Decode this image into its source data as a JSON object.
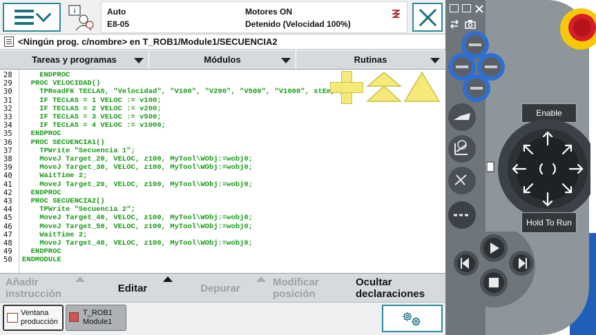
{
  "header": {
    "mode": "Auto",
    "system": "E8-05",
    "motors": "Motores ON",
    "state": "Detenido (Velocidad 100%)"
  },
  "path": "<Ningún prog. c/nombre> en T_ROB1/Module1/SECUENCIA2",
  "tabs": [
    {
      "label": "Tareas y programas"
    },
    {
      "label": "Módulos"
    },
    {
      "label": "Rutinas"
    }
  ],
  "code": {
    "lines": [
      {
        "n": "28",
        "text": "    ENDPROC"
      },
      {
        "n": "29",
        "text": "  PROC VELOCIDAD()"
      },
      {
        "n": "30",
        "text": "    TPReadFK TECLAS, \"Velocidad\", \"V100\", \"V200\", \"V500\", \"V1000\", stEmpty;"
      },
      {
        "n": "31",
        "text": "    IF TECLAS = 1 VELOC := v100;"
      },
      {
        "n": "32",
        "text": "    IF TECLAS = 2 VELOC := v200;"
      },
      {
        "n": "33",
        "text": "    IF TECLAS = 3 VELOC := v500;"
      },
      {
        "n": "34",
        "text": "    IF TECLAS = 4 VELOC := v1000;"
      },
      {
        "n": "35",
        "text": "  ENDPROC"
      },
      {
        "n": "36",
        "text": "  PROC SECUENCIA1()"
      },
      {
        "n": "37",
        "text": "    TPWrite \"Secuencia 1\";"
      },
      {
        "n": "38",
        "text": "    MoveJ Target_20, VELOC, z100, MyTool\\WObj:=wobj0;"
      },
      {
        "n": "39",
        "text": "    MoveJ Target_30, VELOC, z100, MyTool\\WObj:=wobj0;"
      },
      {
        "n": "40",
        "text": "    WaitTime 2;"
      },
      {
        "n": "41",
        "text": "    MoveJ Target_20, VELOC, z100, MyTool\\WObj:=wobj0;"
      },
      {
        "n": "42",
        "text": "  ENDPROC"
      },
      {
        "n": "43",
        "text": "  PROC SECUENCIA2()"
      },
      {
        "n": "44",
        "text": "    TPWrite \"Secuencia 2\";"
      },
      {
        "n": "45",
        "text": "    MoveJ Target_40, VELOC, z100, MyTool\\WObj:=wobj0;"
      },
      {
        "n": "46",
        "text": "    MoveJ Target_50, VELOC, z100, MyTool\\WObj:=wobj0;"
      },
      {
        "n": "47",
        "text": "    WaitTime 2;"
      },
      {
        "n": "48",
        "text": "    MoveJ Target_40, VELOC, z100, MyTool\\WObj:=wobj0;"
      },
      {
        "n": "49",
        "text": "  ENDPROC"
      },
      {
        "n": "50",
        "text": "ENDMODULE"
      }
    ]
  },
  "commands": {
    "anadir": {
      "line1": "Añadir",
      "line2": "instrucción"
    },
    "editar": "Editar",
    "depurar": "Depurar",
    "modificar": {
      "line1": "Modificar",
      "line2": "posición"
    },
    "ocultar": {
      "line1": "Ocultar",
      "line2": "declaraciones"
    }
  },
  "taskbar": {
    "production": {
      "line1": "Ventana",
      "line2": "producción"
    },
    "rob": {
      "line1": "T_ROB1",
      "line2": "Module1"
    }
  },
  "hardware": {
    "enable": "Enable",
    "hold_to_run": "Hold To Run"
  },
  "colors": {
    "code_green": "#1a9a1a",
    "accent_teal": "#2a8a9a",
    "edit_yellow": "#f5ea78",
    "estop_red": "#d4202a",
    "button_blue": "#2f6fd0"
  }
}
